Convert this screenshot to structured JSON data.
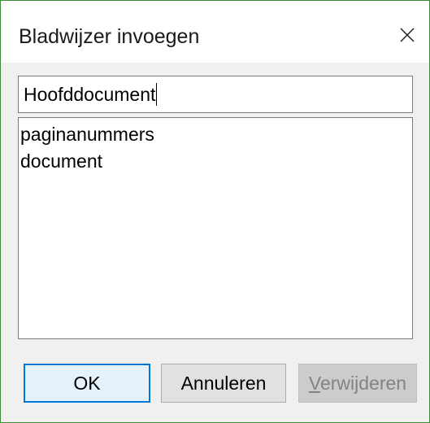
{
  "window": {
    "title": "Bladwijzer invoegen",
    "close_icon": "close-icon"
  },
  "name_input": {
    "value": "Hoofddocument"
  },
  "bookmark_list": {
    "items": [
      {
        "label": "paginanummers"
      },
      {
        "label": "document"
      }
    ]
  },
  "buttons": {
    "ok": "OK",
    "cancel": "Annuleren",
    "delete": "Verwijderen",
    "delete_enabled": false
  },
  "colors": {
    "window_border": "#3c8c3c",
    "focus_accent": "#0078d7",
    "dialog_background": "#f0f0f0"
  }
}
